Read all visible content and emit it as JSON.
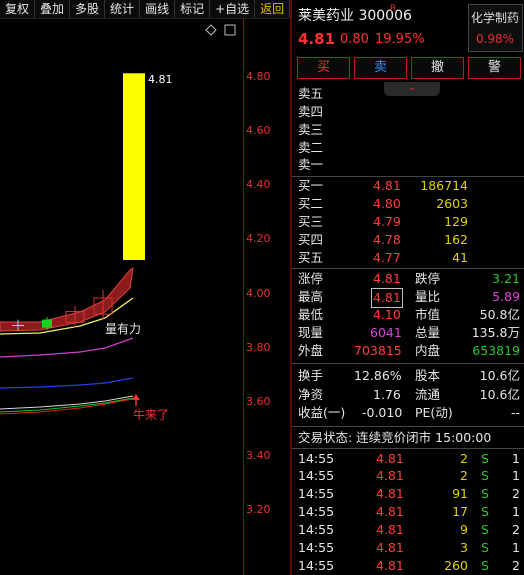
{
  "toolbar": {
    "items": [
      "复权",
      "叠加",
      "多股",
      "统计",
      "画线",
      "标记",
      "+自选",
      "返回"
    ]
  },
  "chart": {
    "y_ticks": [
      "4.80",
      "4.60",
      "4.40",
      "4.20",
      "4.00",
      "3.80",
      "3.60",
      "3.40",
      "3.20"
    ],
    "top_price_label": "4.81",
    "annotation_volume": "量有力",
    "annotation_bull": "牛来了",
    "tools_icons": [
      "diamond-icon",
      "window-icon"
    ]
  },
  "chart_data": {
    "type": "candlestick",
    "ylim": [
      3.1,
      4.9
    ],
    "candles": [
      {
        "open": 3.88,
        "close": 3.88,
        "high": 3.9,
        "low": 3.86,
        "color": "cross"
      },
      {
        "open": 3.87,
        "close": 3.9,
        "high": 3.91,
        "low": 3.86,
        "color": "green"
      },
      {
        "open": 3.89,
        "close": 3.93,
        "high": 3.95,
        "low": 3.87,
        "color": "red"
      },
      {
        "open": 3.92,
        "close": 3.98,
        "high": 4.01,
        "low": 3.9,
        "color": "red"
      },
      {
        "open": 3.95,
        "close": 4.01,
        "high": 4.07,
        "low": 3.94,
        "color": "red"
      },
      {
        "open": 4.12,
        "close": 4.81,
        "high": 4.81,
        "low": 4.12,
        "color": "yellow"
      }
    ]
  },
  "stock": {
    "name_code": "莱美药业 300006",
    "badge": "R",
    "price": "4.81",
    "change": "0.80",
    "change_pct": "19.95%",
    "sector_name": "化学制药",
    "sector_pct": "0.98%"
  },
  "buttons": {
    "buy": "买",
    "sell": "卖",
    "cancel": "撤",
    "alert": "警"
  },
  "sell_levels": [
    "卖五",
    "卖四",
    "卖三",
    "卖二",
    "卖一"
  ],
  "buy_levels": [
    {
      "label": "买一",
      "price": "4.81",
      "vol": "186714"
    },
    {
      "label": "买二",
      "price": "4.80",
      "vol": "2603"
    },
    {
      "label": "买三",
      "price": "4.79",
      "vol": "129"
    },
    {
      "label": "买四",
      "price": "4.78",
      "vol": "162"
    },
    {
      "label": "买五",
      "price": "4.77",
      "vol": "41"
    }
  ],
  "stats": {
    "limit_up_label": "涨停",
    "limit_up": "4.81",
    "limit_down_label": "跌停",
    "limit_down": "3.21",
    "high_label": "最高",
    "high": "4.81",
    "vol_ratio_label": "量比",
    "vol_ratio": "5.89",
    "low_label": "最低",
    "low": "4.10",
    "mkt_cap_label": "市值",
    "mkt_cap": "50.8亿",
    "cur_vol_label": "现量",
    "cur_vol": "6041",
    "total_vol_label": "总量",
    "total_vol": "135.8万",
    "outer_label": "外盘",
    "outer": "703815",
    "inner_label": "内盘",
    "inner": "653819",
    "turnover_label": "换手",
    "turnover": "12.86%",
    "shares_label": "股本",
    "shares": "10.6亿",
    "nav_label": "净资",
    "nav": "1.76",
    "float_label": "流通",
    "float_shares": "10.6亿",
    "eps_label": "收益(一)",
    "eps": "-0.010",
    "pe_label": "PE(动)",
    "pe": "--"
  },
  "trade_status": "交易状态: 连续竞价闭市 15:00:00",
  "ticks": [
    {
      "time": "14:55",
      "price": "4.81",
      "vol": "2",
      "side": "S",
      "n": "1"
    },
    {
      "time": "14:55",
      "price": "4.81",
      "vol": "2",
      "side": "S",
      "n": "1"
    },
    {
      "time": "14:55",
      "price": "4.81",
      "vol": "91",
      "side": "S",
      "n": "2"
    },
    {
      "time": "14:55",
      "price": "4.81",
      "vol": "17",
      "side": "S",
      "n": "1"
    },
    {
      "time": "14:55",
      "price": "4.81",
      "vol": "9",
      "side": "S",
      "n": "2"
    },
    {
      "time": "14:55",
      "price": "4.81",
      "vol": "3",
      "side": "S",
      "n": "1"
    },
    {
      "time": "14:55",
      "price": "4.81",
      "vol": "260",
      "side": "S",
      "n": "2"
    }
  ]
}
